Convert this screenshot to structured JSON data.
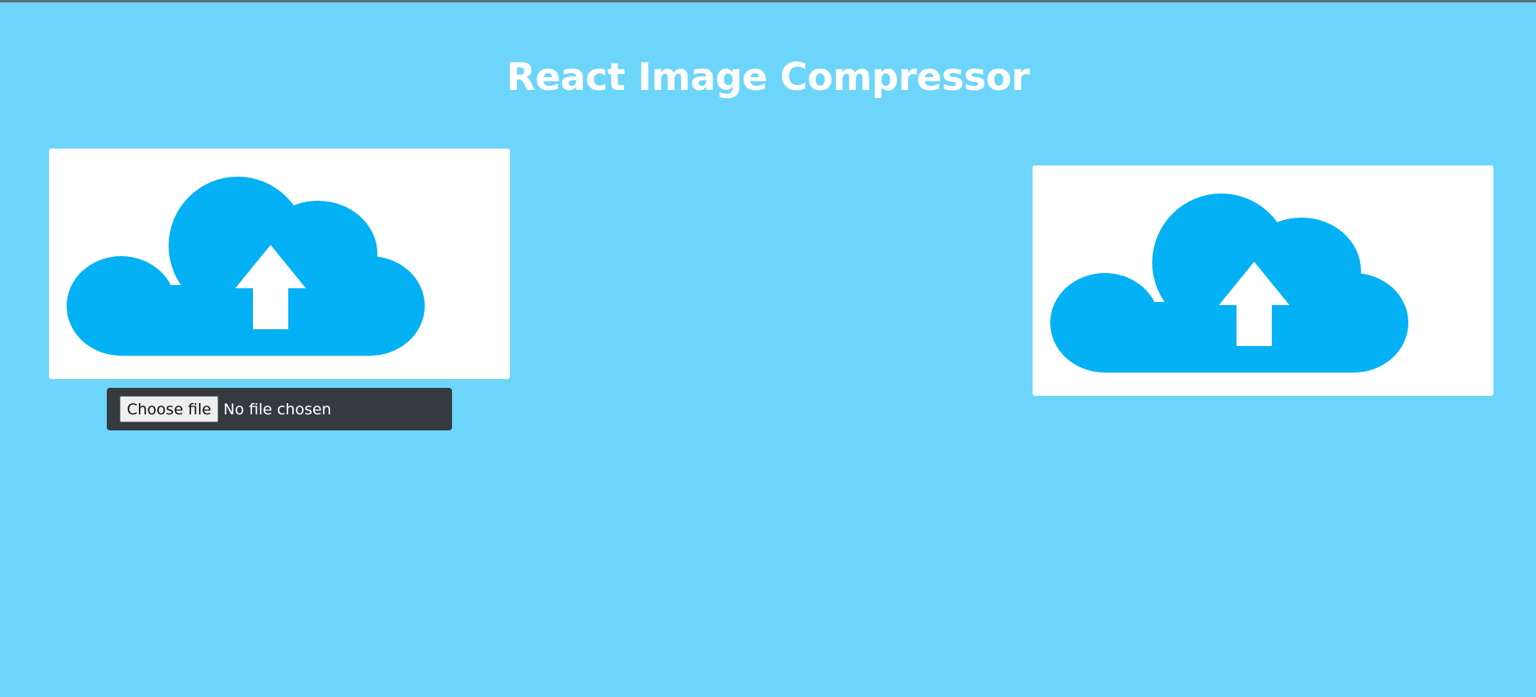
{
  "header": {
    "title": "React Image Compressor"
  },
  "uploader": {
    "choose_label": "Choose file",
    "status_text": "No file chosen"
  },
  "icons": {
    "upload_cloud": "cloud-upload-icon"
  },
  "colors": {
    "background": "#6dd5fa",
    "cloud": "#03b1f4",
    "input_bg": "#343a40"
  }
}
